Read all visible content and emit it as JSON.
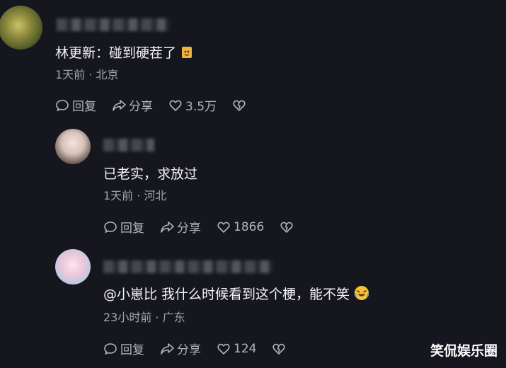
{
  "comments": [
    {
      "text": "林更新：碰到硬茬了",
      "meta": "1天前 · 北京",
      "reply_label": "回复",
      "share_label": "分享",
      "likes": "3.5万"
    },
    {
      "text": "已老实，求放过",
      "meta": "1天前 · 河北",
      "reply_label": "回复",
      "share_label": "分享",
      "likes": "1866"
    },
    {
      "text": "@小崽比  我什么时候看到这个梗，能不笑",
      "meta": "23小时前 · 广东",
      "reply_label": "回复",
      "share_label": "分享",
      "likes": "124"
    }
  ],
  "watermark": "笑侃娱乐圈",
  "icons": [
    "reply-icon",
    "share-icon",
    "like-icon",
    "dislike-icon"
  ]
}
